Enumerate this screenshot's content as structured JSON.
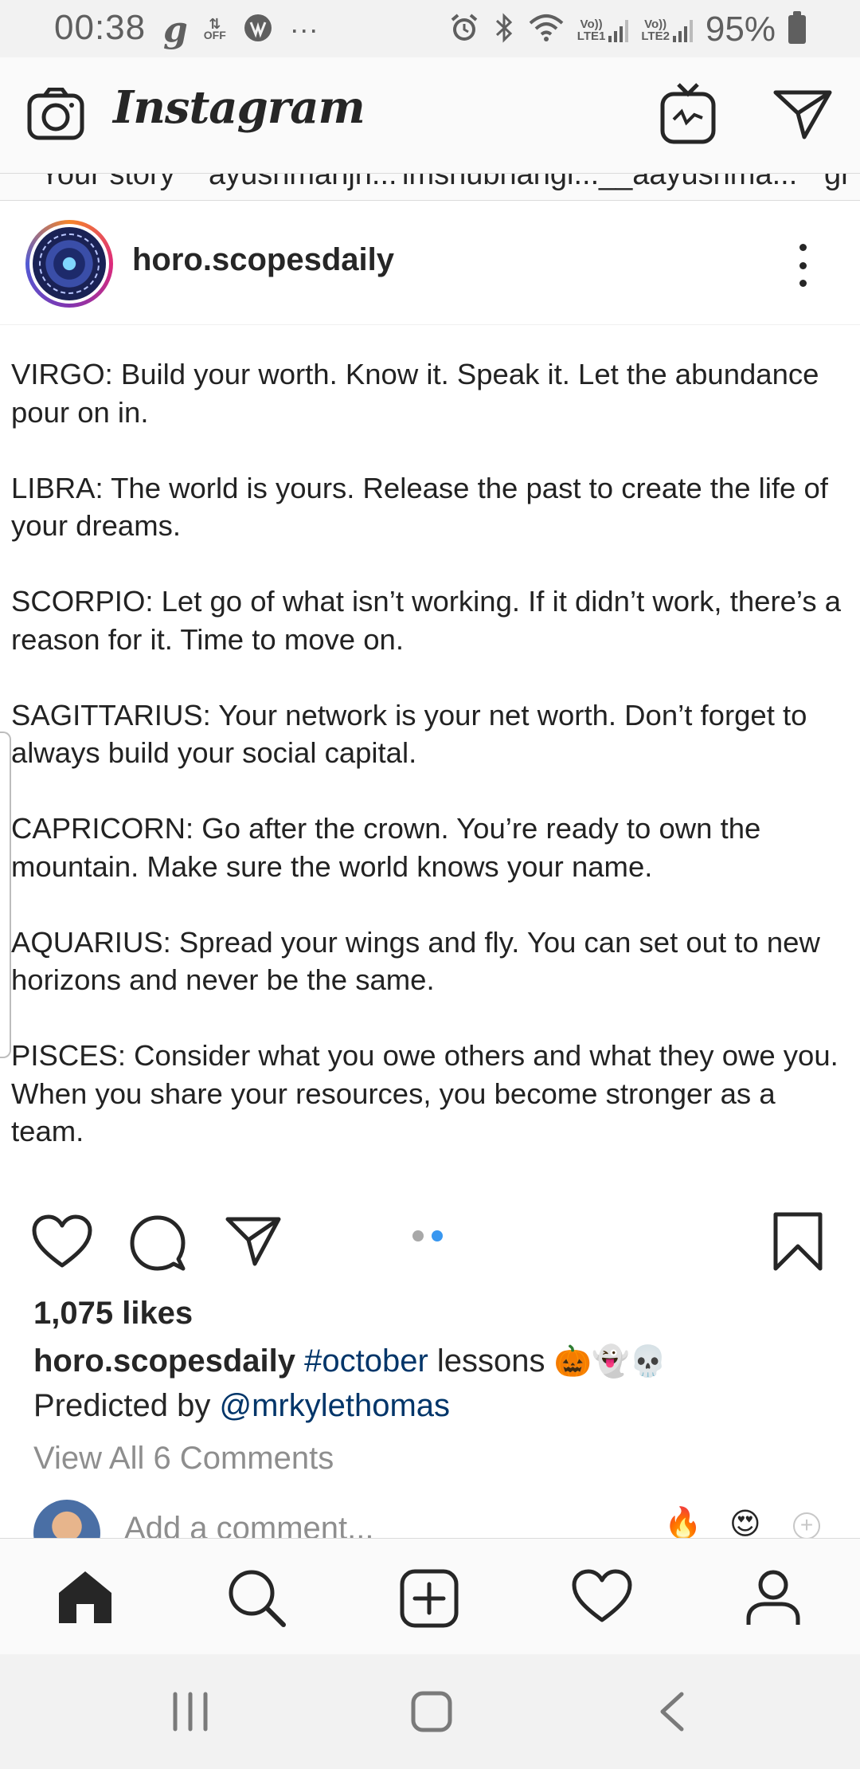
{
  "status_bar": {
    "time": "00:38",
    "left_icons": [
      "g-icon",
      "data-saver-off-icon",
      "vpn-icon",
      "more-notifications-icon"
    ],
    "more": "···",
    "off_label": "OFF",
    "sim1": "LTE1",
    "sim2": "LTE2",
    "volte": "Vo))",
    "battery": "95%"
  },
  "header": {
    "logo": "Instagram",
    "icons": [
      "camera-icon",
      "igtv-icon",
      "direct-message-icon"
    ]
  },
  "stories": {
    "names": [
      "Your story",
      "ayushmanjh...",
      "imshubhangi...",
      "__aayushma...",
      "gr"
    ]
  },
  "post": {
    "username": "horo.scopesdaily",
    "slide_paragraphs": [
      "VIRGO: Build your worth. Know it. Speak it. Let the abundance pour on in.",
      "LIBRA: The world is yours. Release the past to create the life of your dreams.",
      "SCORPIO: Let go of what isn’t working. If it didn’t work, there’s a reason for it. Time to move on.",
      "SAGITTARIUS: Your network is your net worth. Don’t forget to always build your social capital.",
      "CAPRICORN: Go after the crown. You’re ready to own the mountain. Make sure the world knows your name.",
      "AQUARIUS: Spread your wings and fly. You can set out to new horizons and never be the same.",
      "PISCES: Consider what you owe others and what they owe you. When you share your resources, you become stronger as a team."
    ],
    "carousel": {
      "count": 2,
      "active": 2
    },
    "likes": "1,075 likes",
    "caption": {
      "username": "horo.scopesdaily",
      "hashtag": "#october",
      "text": "lessons",
      "emojis": "🎃👻💀"
    },
    "predicted_prefix": "Predicted by",
    "predicted_mention": "@mrkylethomas",
    "view_comments": "View All 6 Comments",
    "add_comment_placeholder": "Add a comment...",
    "quick_emojis": [
      "🔥",
      "😍"
    ],
    "plus": "+"
  },
  "bottom_nav": {
    "items": [
      "home-icon",
      "search-icon",
      "new-post-icon",
      "activity-heart-icon",
      "profile-icon"
    ],
    "active": "home-icon"
  },
  "system_nav": {
    "items": [
      "recent-apps-icon",
      "home-button-icon",
      "back-icon"
    ]
  }
}
